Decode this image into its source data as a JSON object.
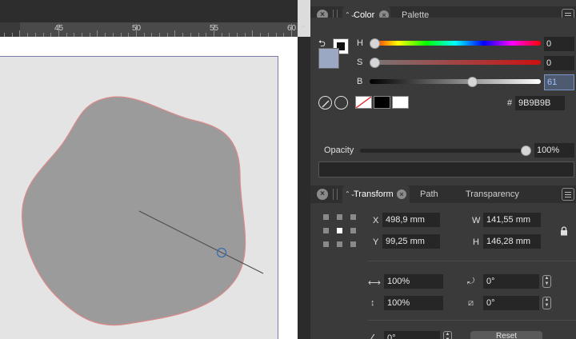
{
  "ruler": {
    "labels": [
      "45",
      "50",
      "55",
      "60"
    ],
    "arrow_icon": "chevron-up-icon"
  },
  "color_panel": {
    "tabs": [
      {
        "label": "Color"
      },
      {
        "label": "Palette"
      }
    ],
    "sliders": [
      {
        "label": "H",
        "value": "0"
      },
      {
        "label": "S",
        "value": "0"
      },
      {
        "label": "B",
        "value": "61"
      }
    ],
    "hex_prefix": "#",
    "hex_value": "9B9B9B",
    "opacity_label": "Opacity",
    "opacity_value": "100%",
    "colors": {
      "fill": "#9aa8c4",
      "shape_fill": "#9b9b9b",
      "shape_stroke": "#d98a8a"
    }
  },
  "transform_panel": {
    "tabs": [
      {
        "label": "Transform"
      },
      {
        "label": "Path"
      },
      {
        "label": "Transparency"
      }
    ],
    "x_label": "X",
    "x_value": "498,9 mm",
    "y_label": "Y",
    "y_value": "99,25 mm",
    "w_label": "W",
    "w_value": "141,55 mm",
    "h_label": "H",
    "h_value": "146,28 mm",
    "scale_w_value": "100%",
    "scale_h_value": "100%",
    "rotation_value": "0°",
    "shear_value": "0°",
    "angle_value": "0°",
    "reset_label": "Reset"
  }
}
